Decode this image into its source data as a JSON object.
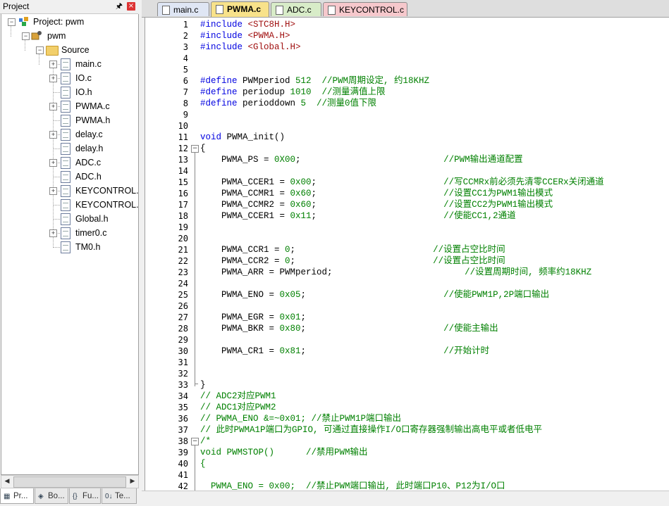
{
  "project_panel": {
    "title": "Project",
    "pin": "ᵰ",
    "close": "×",
    "tree": {
      "project": "Project: pwm",
      "target": "pwm",
      "group": "Source",
      "files": [
        {
          "name": "main.c",
          "expandable": true
        },
        {
          "name": "IO.c",
          "expandable": true
        },
        {
          "name": "IO.h",
          "expandable": false
        },
        {
          "name": "PWMA.c",
          "expandable": true
        },
        {
          "name": "PWMA.h",
          "expandable": false
        },
        {
          "name": "delay.c",
          "expandable": true
        },
        {
          "name": "delay.h",
          "expandable": false
        },
        {
          "name": "ADC.c",
          "expandable": true
        },
        {
          "name": "ADC.h",
          "expandable": false
        },
        {
          "name": "KEYCONTROL.c",
          "expandable": true
        },
        {
          "name": "KEYCONTROL.h",
          "expandable": false
        },
        {
          "name": "Global.h",
          "expandable": false
        },
        {
          "name": "timer0.c",
          "expandable": true
        },
        {
          "name": "TM0.h",
          "expandable": false
        }
      ]
    },
    "bottom_tabs": [
      {
        "label": "Pr...",
        "icon": "project-icon"
      },
      {
        "label": "Bo...",
        "icon": "books-icon"
      },
      {
        "label": "Fu...",
        "icon": "functions-icon"
      },
      {
        "label": "Te...",
        "icon": "templates-icon"
      }
    ]
  },
  "editor": {
    "tabs": [
      {
        "label": "main.c",
        "color": "#dfe6f4"
      },
      {
        "label": "PWMA.c",
        "color": "#f8e28a",
        "active": true
      },
      {
        "label": "ADC.c",
        "color": "#d8ecc8"
      },
      {
        "label": "KEYCONTROL.c",
        "color": "#f6c8cc"
      }
    ],
    "lines": [
      {
        "n": "1",
        "t": [
          [
            "kw",
            "#include "
          ],
          [
            "str",
            "<STC8H.H>"
          ]
        ]
      },
      {
        "n": "2",
        "t": [
          [
            "kw",
            "#include "
          ],
          [
            "str",
            "<PWMA.H>"
          ]
        ]
      },
      {
        "n": "3",
        "t": [
          [
            "kw",
            "#include "
          ],
          [
            "str",
            "<Global.H>"
          ]
        ]
      },
      {
        "n": "4",
        "t": []
      },
      {
        "n": "5",
        "t": []
      },
      {
        "n": "6",
        "t": [
          [
            "kw",
            "#define "
          ],
          [
            "txt",
            "PWMperiod "
          ],
          [
            "num",
            "512  "
          ],
          [
            "com",
            "//PWM周期设定, 约18KHZ"
          ]
        ]
      },
      {
        "n": "7",
        "t": [
          [
            "kw",
            "#define "
          ],
          [
            "txt",
            "periodup "
          ],
          [
            "num",
            "1010  "
          ],
          [
            "com",
            "//测量满值上限"
          ]
        ]
      },
      {
        "n": "8",
        "t": [
          [
            "kw",
            "#define "
          ],
          [
            "txt",
            "perioddown "
          ],
          [
            "num",
            "5  "
          ],
          [
            "com",
            "//测量0值下限"
          ]
        ]
      },
      {
        "n": "9",
        "t": []
      },
      {
        "n": "10",
        "t": []
      },
      {
        "n": "11",
        "t": [
          [
            "kw",
            "void "
          ],
          [
            "txt",
            "PWMA_init()"
          ]
        ]
      },
      {
        "n": "12",
        "t": [
          [
            "txt",
            "{"
          ]
        ]
      },
      {
        "n": "13",
        "t": [
          [
            "txt",
            "    PWMA_PS = "
          ],
          [
            "num",
            "0X00"
          ],
          [
            "txt",
            ";                           "
          ],
          [
            "com",
            "//PWM输出通道配置"
          ]
        ]
      },
      {
        "n": "14",
        "t": []
      },
      {
        "n": "15",
        "t": [
          [
            "txt",
            "    PWMA_CCER1 = "
          ],
          [
            "num",
            "0x00"
          ],
          [
            "txt",
            ";                        "
          ],
          [
            "com",
            "//写CCMRx前必须先清零CCERx关闭通道"
          ]
        ]
      },
      {
        "n": "16",
        "t": [
          [
            "txt",
            "    PWMA_CCMR1 = "
          ],
          [
            "num",
            "0x60"
          ],
          [
            "txt",
            ";                        "
          ],
          [
            "com",
            "//设置CC1为PWM1输出模式"
          ]
        ]
      },
      {
        "n": "17",
        "t": [
          [
            "txt",
            "    PWMA_CCMR2 = "
          ],
          [
            "num",
            "0x60"
          ],
          [
            "txt",
            ";                        "
          ],
          [
            "com",
            "//设置CC2为PWM1输出模式"
          ]
        ]
      },
      {
        "n": "18",
        "t": [
          [
            "txt",
            "    PWMA_CCER1 = "
          ],
          [
            "num",
            "0x11"
          ],
          [
            "txt",
            ";                        "
          ],
          [
            "com",
            "//使能CC1,2通道"
          ]
        ]
      },
      {
        "n": "19",
        "t": []
      },
      {
        "n": "20",
        "t": []
      },
      {
        "n": "21",
        "t": [
          [
            "txt",
            "    PWMA_CCR1 = "
          ],
          [
            "num",
            "0"
          ],
          [
            "txt",
            ";                          "
          ],
          [
            "com",
            "//设置占空比时间"
          ]
        ]
      },
      {
        "n": "22",
        "t": [
          [
            "txt",
            "    PWMA_CCR2 = "
          ],
          [
            "num",
            "0"
          ],
          [
            "txt",
            ";                          "
          ],
          [
            "com",
            "//设置占空比时间"
          ]
        ]
      },
      {
        "n": "23",
        "t": [
          [
            "txt",
            "    PWMA_ARR = PWMperiod;                         "
          ],
          [
            "com",
            "//设置周期时间, 频率约18KHZ"
          ]
        ]
      },
      {
        "n": "24",
        "t": []
      },
      {
        "n": "25",
        "t": [
          [
            "txt",
            "    PWMA_ENO = "
          ],
          [
            "num",
            "0x05"
          ],
          [
            "txt",
            ";                          "
          ],
          [
            "com",
            "//使能PWM1P,2P端口输出"
          ]
        ]
      },
      {
        "n": "26",
        "t": []
      },
      {
        "n": "27",
        "t": [
          [
            "txt",
            "    PWMA_EGR = "
          ],
          [
            "num",
            "0x01"
          ],
          [
            "txt",
            ";"
          ]
        ]
      },
      {
        "n": "28",
        "t": [
          [
            "txt",
            "    PWMA_BKR = "
          ],
          [
            "num",
            "0x80"
          ],
          [
            "txt",
            ";                          "
          ],
          [
            "com",
            "//使能主输出"
          ]
        ]
      },
      {
        "n": "29",
        "t": []
      },
      {
        "n": "30",
        "t": [
          [
            "txt",
            "    PWMA_CR1 = "
          ],
          [
            "num",
            "0x81"
          ],
          [
            "txt",
            ";                          "
          ],
          [
            "com",
            "//开始计时"
          ]
        ]
      },
      {
        "n": "31",
        "t": []
      },
      {
        "n": "32",
        "t": []
      },
      {
        "n": "33",
        "t": [
          [
            "txt",
            "}"
          ]
        ]
      },
      {
        "n": "34",
        "t": [
          [
            "com",
            "// ADC2对应PWM1"
          ]
        ]
      },
      {
        "n": "35",
        "t": [
          [
            "com",
            "// ADC1对应PWM2"
          ]
        ]
      },
      {
        "n": "36",
        "t": [
          [
            "com",
            "// PWMA_ENO &=~0x01; //禁止PWM1P端口输出"
          ]
        ]
      },
      {
        "n": "37",
        "t": [
          [
            "com",
            "// 此时PWMA1P端口为GPIO, 可通过直接操作I/O口寄存器强制输出高电平或者低电平"
          ]
        ]
      },
      {
        "n": "38",
        "t": [
          [
            "com",
            "/*"
          ]
        ]
      },
      {
        "n": "39",
        "t": [
          [
            "com",
            "void PWMSTOP()      //禁用PWM输出"
          ]
        ]
      },
      {
        "n": "40",
        "t": [
          [
            "com",
            "{"
          ]
        ]
      },
      {
        "n": "41",
        "t": []
      },
      {
        "n": "42",
        "t": [
          [
            "com",
            "  PWMA_ENO = 0x00;  //禁止PWM端口输出, 此时端口P10、P12为I/O口"
          ]
        ]
      }
    ]
  }
}
